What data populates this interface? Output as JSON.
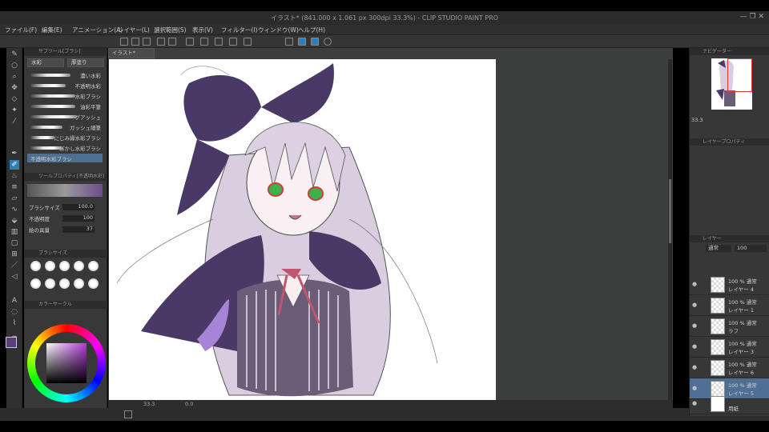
{
  "window": {
    "title": "イラスト* (841.000 x 1.061 px 300dpi 33.3%) - CLIP STUDIO PAINT PRO",
    "controls": "— ❐ ✕"
  },
  "menu": [
    "ファイル(F)",
    "編集(E)",
    "アニメーション(A)",
    "レイヤー(L)",
    "選択範囲(S)",
    "表示(V)",
    "フィルター(I)",
    "ウィンドウ(W)",
    "ヘルプ(H)"
  ],
  "document_tab": "イラスト*",
  "left_panel": {
    "subtool_header": "サブツール[ブラシ]",
    "subtool_tabs": [
      "水彩",
      "厚塗り"
    ],
    "brushes": [
      "濃い水彩",
      "不透明水彩",
      "水彩ブラシ",
      "油彩平筆",
      "グアッシュ",
      "ガッシュ細筆",
      "にじみ縁水彩ブラシ",
      "ぼかし水彩ブラシ",
      "不透明水彩ブラシ"
    ],
    "tool_property_header": "ツールプロパティ[不透明水彩]",
    "props": [
      {
        "label": "ブラシサイズ",
        "value": "100.0"
      },
      {
        "label": "不透明度",
        "value": "100"
      },
      {
        "label": "絵の具量",
        "value": "37"
      }
    ],
    "brush_size_header": "ブラシサイズ",
    "color_header": "カラーサークル",
    "main_color": "#5a3d7a"
  },
  "status": {
    "zoom": "33.3",
    "angle": "0.0"
  },
  "right_panel": {
    "navigator_header": "ナビゲーター",
    "navigator_zoom": "33.3",
    "layer_property_header": "レイヤープロパティ",
    "layer_header": "レイヤー",
    "blend_mode": "通常",
    "opacity": "100",
    "layers": [
      {
        "pct": "100 % 通常",
        "name": "レイヤー 4"
      },
      {
        "pct": "100 % 通常",
        "name": "レイヤー 1"
      },
      {
        "pct": "100 % 通常",
        "name": "ラフ"
      },
      {
        "pct": "100 % 通常",
        "name": "レイヤー 3"
      },
      {
        "pct": "100 % 通常",
        "name": "レイヤー 6"
      },
      {
        "pct": "100 % 通常",
        "name": "レイヤー 5"
      },
      {
        "pct": "",
        "name": "用紙"
      }
    ]
  }
}
